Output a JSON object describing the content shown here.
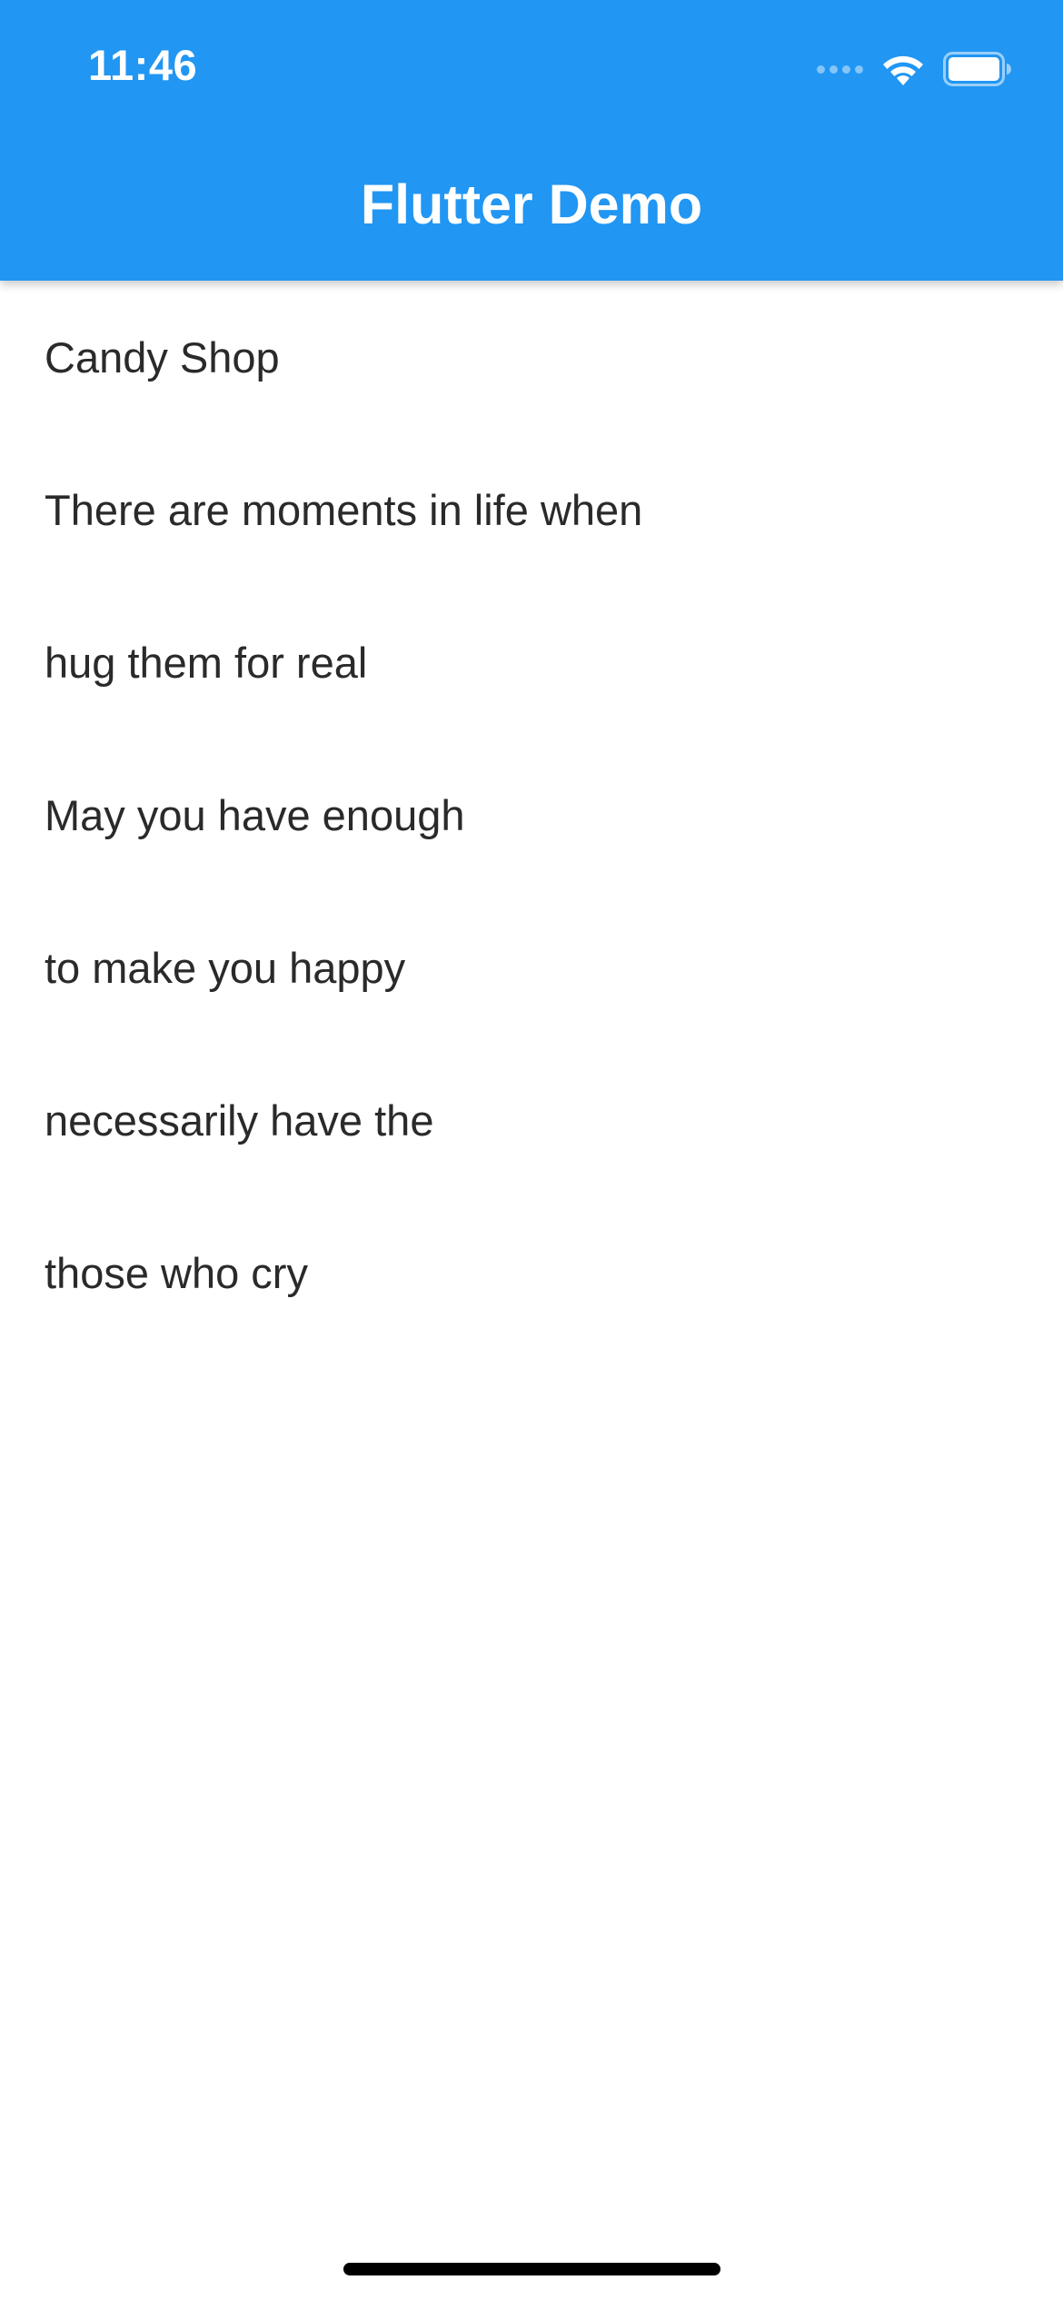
{
  "status_bar": {
    "time": "11:46"
  },
  "app_bar": {
    "title": "Flutter Demo",
    "color": "#2196F3"
  },
  "list": {
    "items": [
      "Candy Shop",
      "There are moments in life when",
      "hug them for real",
      "May you have enough",
      "to make you happy",
      "necessarily have the",
      "those who cry"
    ]
  },
  "icons": {
    "signal": "cellular-signal-icon",
    "wifi": "wifi-icon",
    "battery": "battery-icon"
  }
}
